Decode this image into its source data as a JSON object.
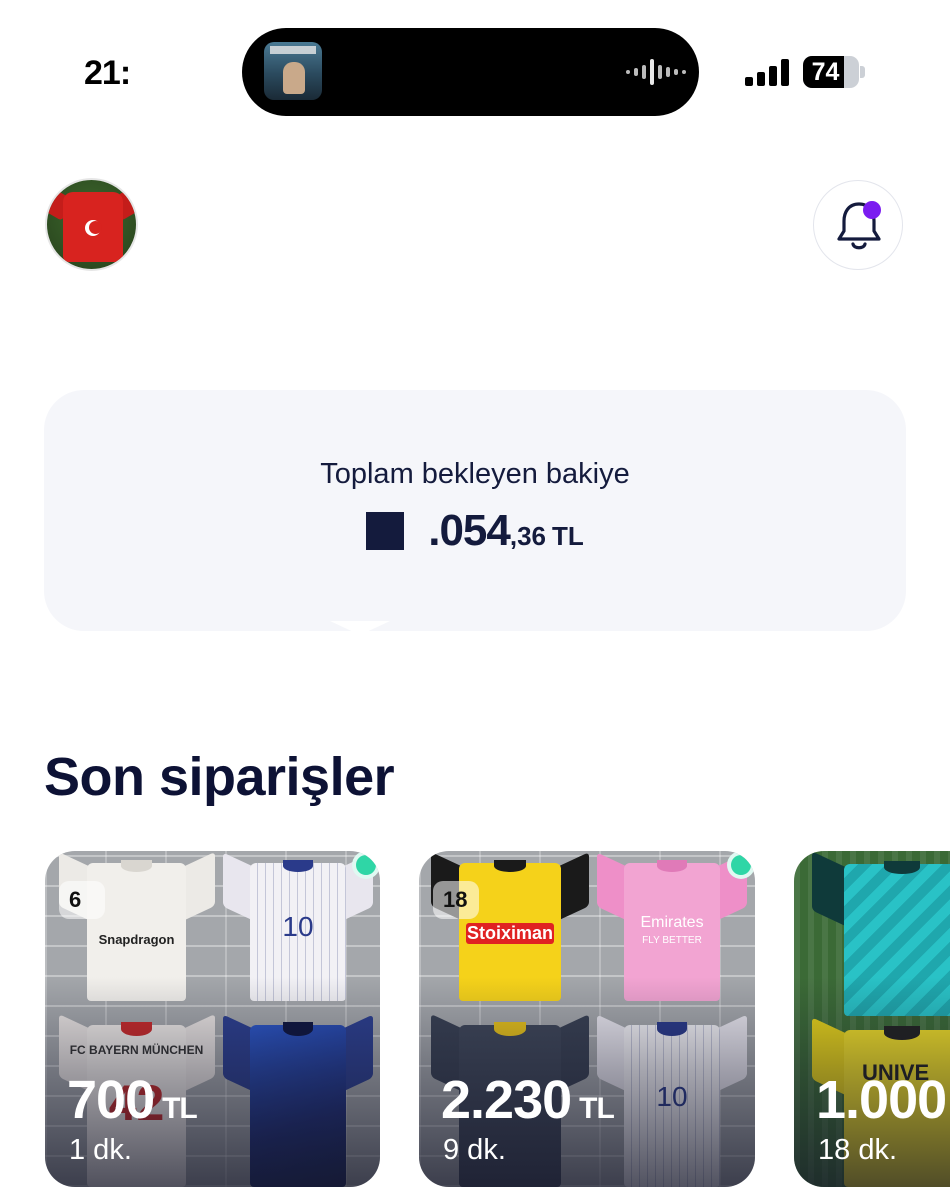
{
  "status_bar": {
    "time": "21:",
    "battery": "74",
    "battery_level": 0.74
  },
  "header": {
    "avatar": "profile-avatar",
    "notification_icon": "bell-icon",
    "has_unread": true
  },
  "balance": {
    "label": "Toplam bekleyen bakiye",
    "amount_visible": ".054",
    "amount_decimal": ",36",
    "currency": "TL"
  },
  "recent_orders": {
    "title": "Son siparişler",
    "items": [
      {
        "count": "6",
        "price": "700",
        "currency": "TL",
        "time": "1 dk."
      },
      {
        "count": "18",
        "price": "2.230",
        "currency": "TL",
        "time": "9 dk."
      },
      {
        "count": "",
        "price": "1.000",
        "currency": "",
        "time": "18 dk."
      }
    ]
  },
  "colors": {
    "primary_text": "#141b3d",
    "card_bg": "#f5f6fa",
    "notification_dot": "#7b1cf0",
    "new_order_dot": "#2fd6a6"
  }
}
